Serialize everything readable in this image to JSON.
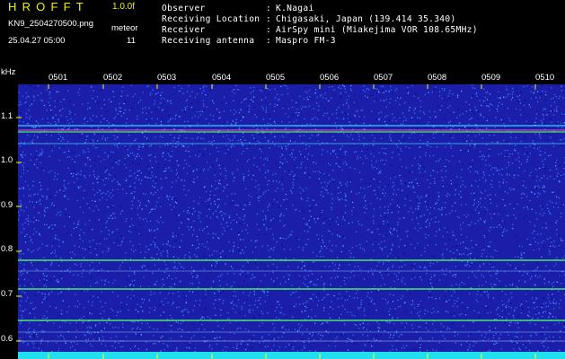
{
  "header": {
    "app_title": "HROFFT",
    "app_version": "1.0.0f",
    "file_name": "KN9_2504270500.png",
    "meteo_label": "meteor",
    "datetime": "25.04.27 05:00",
    "meteo_count": "11"
  },
  "info": [
    {
      "key": "Observer",
      "value": "K.Nagai"
    },
    {
      "key": "Receiving Location",
      "value": "Chigasaki, Japan (139.414 35.340)"
    },
    {
      "key": "Receiver",
      "value": "AirSpy mini (Miakejima VOR 108.65MHz)"
    },
    {
      "key": "Receiving antenna",
      "value": "Maspro FM-3"
    }
  ],
  "spectrogram": {
    "y_unit": "kHz",
    "y_ticks": [
      "1.1",
      "1.0",
      "0.9",
      "0.8",
      "0.7",
      "0.6"
    ],
    "x_ticks": [
      "0501",
      "0502",
      "0503",
      "0504",
      "0505",
      "0506",
      "0507",
      "0508",
      "0509",
      "0510"
    ],
    "colors": {
      "background": "#1a1ea8",
      "noise_light": "#3a70ff",
      "trace_green": "#50ff60",
      "trace_cyan": "#40e0ff",
      "bottom_band": "#20e0f0",
      "tick": "#ffff00"
    }
  }
}
